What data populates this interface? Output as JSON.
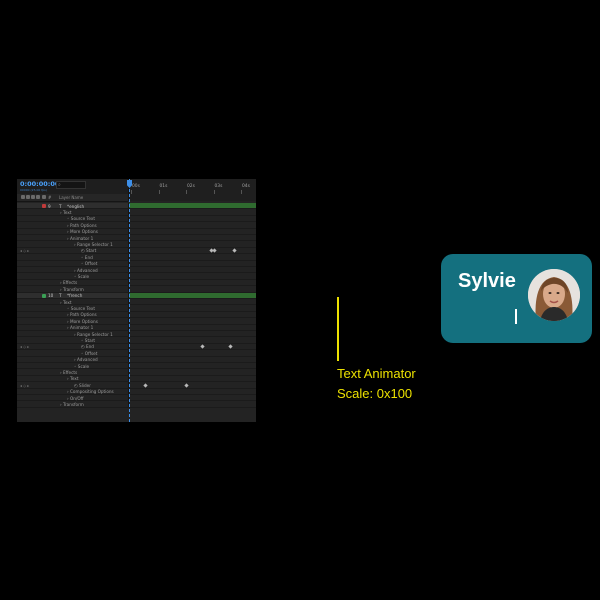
{
  "timeline": {
    "timecode": "0:00:00:00",
    "timecode_sub": "00000 (25.00 fps)",
    "column_header": {
      "hash": "#",
      "layer_name": "Layer Name"
    },
    "ruler_ticks": [
      "00s",
      "01s",
      "02s",
      "03s",
      "04s"
    ],
    "rows": [
      {
        "label": "*english",
        "number": "9",
        "type": "layer",
        "swatch": "#c03a3a",
        "keys": []
      },
      {
        "label": "Text",
        "type": "group",
        "keys": []
      },
      {
        "label": "Source Text",
        "type": "prop",
        "keys": []
      },
      {
        "label": "Path Options",
        "type": "group",
        "keys": []
      },
      {
        "label": "More Options",
        "type": "group",
        "keys": []
      },
      {
        "label": "Animator 1",
        "type": "group",
        "keys": []
      },
      {
        "label": "Range Selector 1",
        "type": "group",
        "keys": []
      },
      {
        "label": "Start",
        "type": "keyed",
        "keys": [
          0.63,
          0.66,
          0.81
        ]
      },
      {
        "label": "End",
        "type": "prop",
        "keys": []
      },
      {
        "label": "Offset",
        "type": "prop",
        "keys": []
      },
      {
        "label": "Advanced",
        "type": "group",
        "keys": []
      },
      {
        "label": "Scale",
        "type": "prop",
        "keys": []
      },
      {
        "label": "Effects",
        "type": "group",
        "keys": []
      },
      {
        "label": "Transform",
        "type": "group",
        "keys": []
      },
      {
        "label": "*french",
        "number": "10",
        "type": "layer",
        "swatch": "#3aa055",
        "keys": []
      },
      {
        "label": "Text",
        "type": "group",
        "keys": []
      },
      {
        "label": "Source Text",
        "type": "prop",
        "keys": []
      },
      {
        "label": "Path Options",
        "type": "group",
        "keys": []
      },
      {
        "label": "More Options",
        "type": "group",
        "keys": []
      },
      {
        "label": "Animator 1",
        "type": "group",
        "keys": []
      },
      {
        "label": "Range Selector 1",
        "type": "group",
        "keys": []
      },
      {
        "label": "Start",
        "type": "prop",
        "keys": []
      },
      {
        "label": "End",
        "type": "keyed",
        "keys": [
          0.56,
          0.78
        ]
      },
      {
        "label": "Offset",
        "type": "prop",
        "keys": []
      },
      {
        "label": "Advanced",
        "type": "group",
        "keys": []
      },
      {
        "label": "Scale",
        "type": "prop",
        "keys": []
      },
      {
        "label": "Effects",
        "type": "group",
        "keys": []
      },
      {
        "label": "Text",
        "type": "group",
        "keys": []
      },
      {
        "label": "Slider",
        "type": "keyed",
        "keys": [
          0.12,
          0.44
        ]
      },
      {
        "label": "Compositing Options",
        "type": "group",
        "keys": []
      },
      {
        "label": "On/Off",
        "type": "group",
        "keys": []
      },
      {
        "label": "Transform",
        "type": "group",
        "keys": []
      }
    ]
  },
  "annotation": {
    "line1": "Text Animator",
    "line2": "Scale: 0x100",
    "accent_color": "#ece100"
  },
  "card": {
    "name": "Sylvie",
    "background": "#14707f",
    "avatar": "portrait-photo"
  }
}
